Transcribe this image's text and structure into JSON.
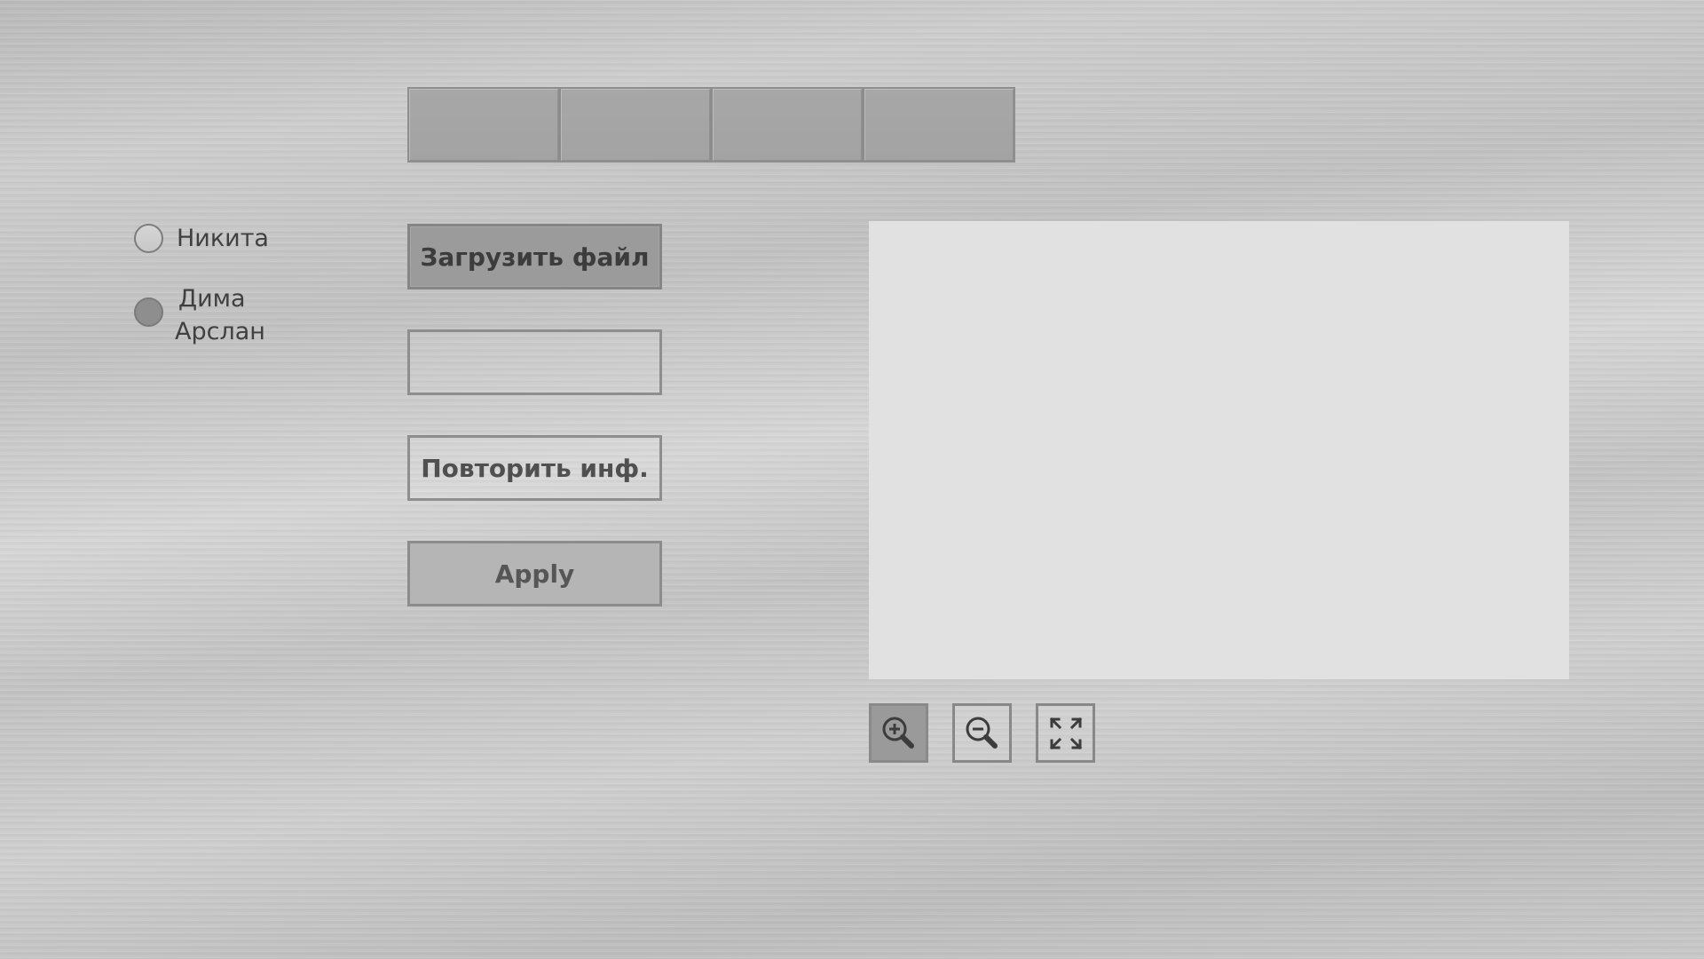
{
  "tabs": [
    "",
    "",
    "",
    ""
  ],
  "radio_group": {
    "options": [
      {
        "label": "Никита",
        "selected": false
      },
      {
        "label_lines": [
          "Дима",
          "Арслан"
        ],
        "selected": true
      }
    ]
  },
  "controls": {
    "upload_label": "Загрузить файл",
    "text_value": "",
    "repeat_label": "Повторить инф.",
    "apply_label": "Apply"
  },
  "tools": {
    "zoom_in_icon": "zoom-in-icon",
    "zoom_out_icon": "zoom-out-icon",
    "fit_icon": "expand-icon"
  },
  "colors": {
    "selected_radio": "#8e8e8e",
    "preview_background": "#e1e1e1"
  }
}
